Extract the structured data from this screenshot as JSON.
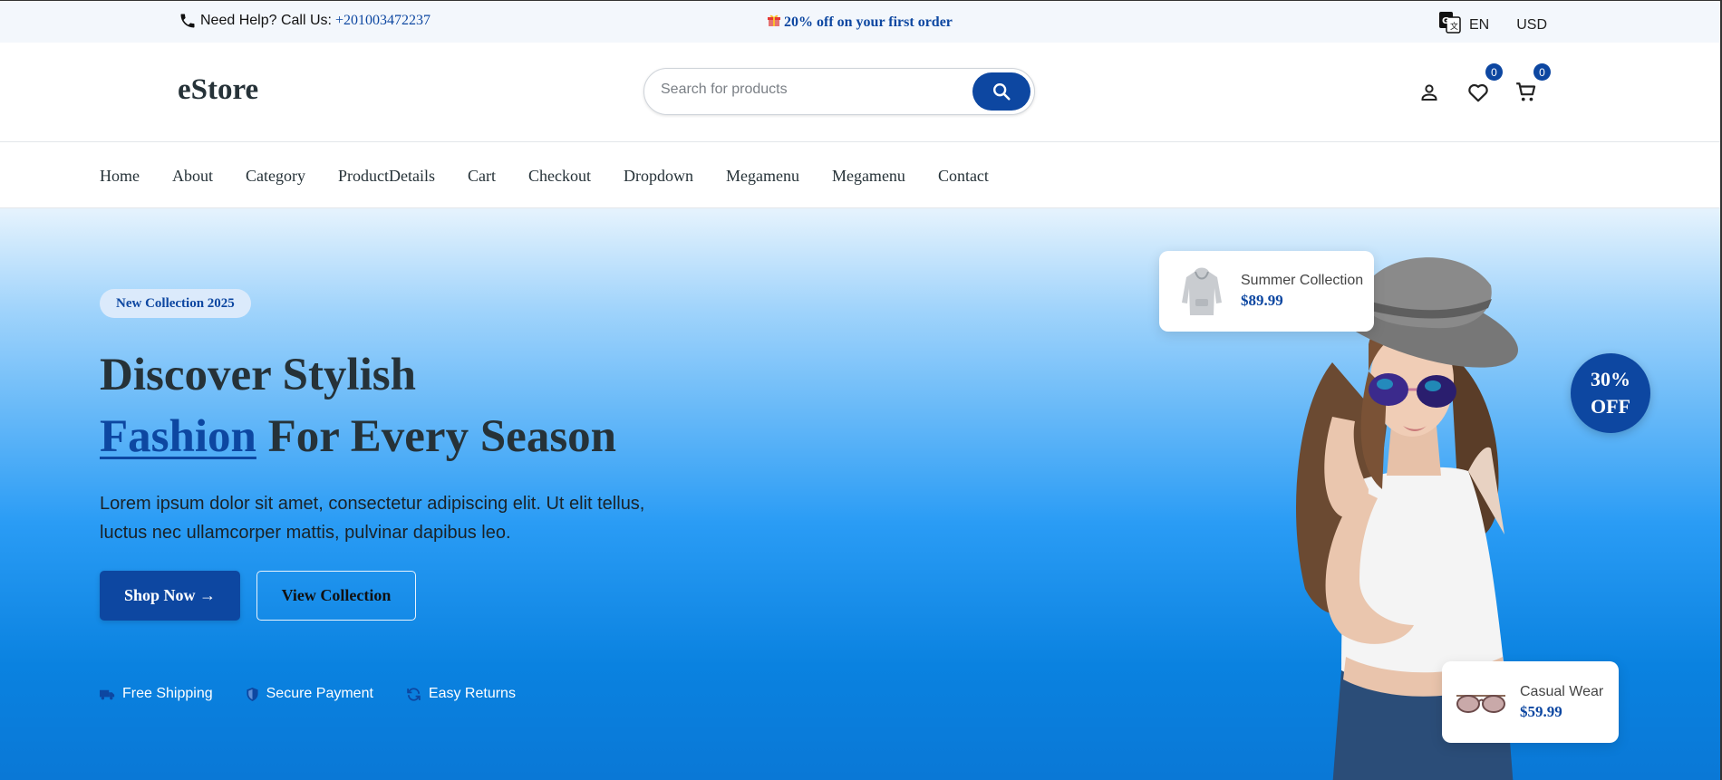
{
  "topbar": {
    "help_text": "Need Help? Call Us:",
    "phone": "+201003472237",
    "promo": "20% off on your first order",
    "language": "EN",
    "currency": "USD"
  },
  "header": {
    "logo": "eStore",
    "search_placeholder": "Search for products",
    "wishlist_count": "0",
    "cart_count": "0"
  },
  "nav": {
    "items": [
      "Home",
      "About",
      "Category",
      "ProductDetails",
      "Cart",
      "Checkout",
      "Dropdown",
      "Megamenu",
      "Megamenu",
      "Contact"
    ]
  },
  "hero": {
    "tag": "New Collection 2025",
    "title_line1": "Discover Stylish",
    "title_highlight": "Fashion",
    "title_line2_rest": " For Every Season",
    "description": "Lorem ipsum dolor sit amet, consectetur adipiscing elit. Ut elit tellus, luctus nec ullamcorper mattis, pulvinar dapibus leo.",
    "primary_button": "Shop Now →",
    "secondary_button": "View Collection",
    "features": [
      "Free Shipping",
      "Secure Payment",
      "Easy Returns"
    ],
    "discount_line1": "30%",
    "discount_line2": "OFF",
    "product_cards": [
      {
        "name": "Summer Collection",
        "price": "$89.99"
      },
      {
        "name": "Casual Wear",
        "price": "$59.99"
      }
    ]
  },
  "colors": {
    "primary": "#0d47a1",
    "text_dark": "#263238"
  }
}
